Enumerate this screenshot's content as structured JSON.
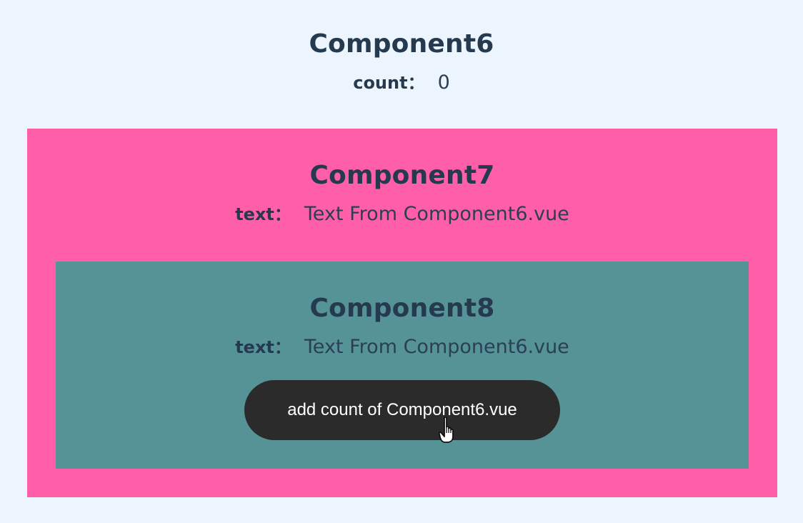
{
  "component6": {
    "title": "Component6",
    "count_label": "count：",
    "count_value": "0"
  },
  "component7": {
    "title": "Component7",
    "text_label": "text：",
    "text_value": "Text From Component6.vue"
  },
  "component8": {
    "title": "Component8",
    "text_label": "text：",
    "text_value": "Text From Component6.vue",
    "button_label": "add count of Component6.vue"
  },
  "colors": {
    "page_background": "#ecf5fd",
    "component7_background": "#ff5fa8",
    "component8_background": "#559396",
    "button_background": "#2b2b2b",
    "heading_text": "#253a4f"
  },
  "icons": {
    "cursor": "hand-pointer-cursor-icon"
  }
}
